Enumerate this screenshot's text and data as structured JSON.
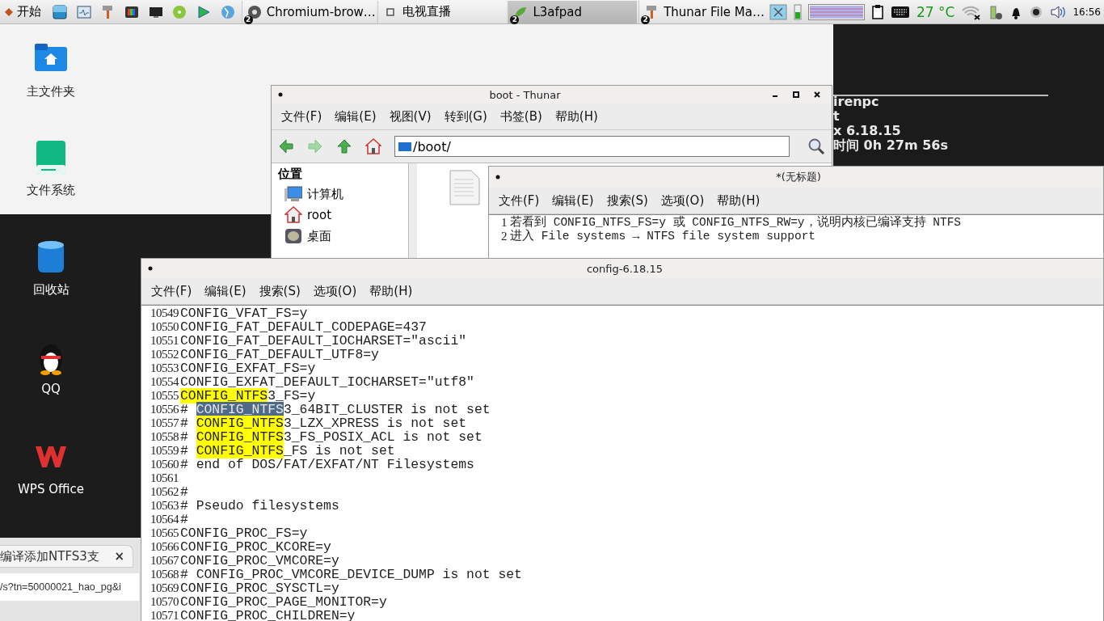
{
  "taskbar": {
    "start_label": "开始",
    "tasks": [
      {
        "label": "Chromium-brow…",
        "badge": "2",
        "kind": "browser",
        "selected": false
      },
      {
        "label": "电视直播",
        "kind": "tv",
        "selected": false
      },
      {
        "label": "L3afpad",
        "badge": "2",
        "kind": "editor",
        "selected": true
      },
      {
        "label": "Thunar File Ma…",
        "badge": "2",
        "kind": "files",
        "selected": false
      }
    ],
    "temperature": "27 °C",
    "clock": "16:56"
  },
  "desktop_icons": [
    {
      "label": "主文件夹",
      "kind": "home"
    },
    {
      "label": "文件系统",
      "kind": "drive"
    },
    {
      "label": "回收站",
      "kind": "trash"
    },
    {
      "label": "QQ",
      "kind": "penguin"
    },
    {
      "label": "WPS Office",
      "kind": "wps"
    }
  ],
  "system_info": {
    "lines": [
      "irenpc",
      "t",
      "x 6.18.15",
      "时间 0h 27m 56s"
    ]
  },
  "browser_fragment": {
    "tab_title": "编译添加NTFS3支",
    "close": "×",
    "address": "/s?tn=50000021_hao_pg&i"
  },
  "thunar": {
    "title": "boot - Thunar",
    "menu": [
      "文件(F)",
      "编辑(E)",
      "视图(V)",
      "转到(G)",
      "书签(B)",
      "帮助(H)"
    ],
    "path": "/boot/",
    "sidebar": {
      "heading": "位置",
      "items": [
        {
          "label": "计算机",
          "kind": "computer"
        },
        {
          "label": "root",
          "kind": "home"
        },
        {
          "label": "桌面",
          "kind": "desktop"
        }
      ]
    }
  },
  "notes_editor": {
    "title": "*(无标题)",
    "menu": [
      "文件(F)",
      "编辑(E)",
      "搜索(S)",
      "选项(O)",
      "帮助(H)"
    ],
    "lines": [
      {
        "number": "1",
        "text": "若看到 CONFIG_NTFS_FS=y 或 CONFIG_NTFS_RW=y，说明内核已编译支持 NTFS"
      },
      {
        "number": "2",
        "text": "进入 File systems → NTFS file system support"
      }
    ]
  },
  "config_editor": {
    "title": "config-6.18.15",
    "menu": [
      "文件(F)",
      "编辑(E)",
      "搜索(S)",
      "选项(O)",
      "帮助(H)"
    ],
    "lines": [
      {
        "number": "10549",
        "segments": [
          {
            "text": "CONFIG_VFAT_FS=y",
            "kind": "plain"
          }
        ]
      },
      {
        "number": "10550",
        "segments": [
          {
            "text": "CONFIG_FAT_DEFAULT_CODEPAGE=437",
            "kind": "plain"
          }
        ]
      },
      {
        "number": "10551",
        "segments": [
          {
            "text": "CONFIG_FAT_DEFAULT_IOCHARSET=\"ascii\"",
            "kind": "plain"
          }
        ]
      },
      {
        "number": "10552",
        "segments": [
          {
            "text": "CONFIG_FAT_DEFAULT_UTF8=y",
            "kind": "plain"
          }
        ]
      },
      {
        "number": "10553",
        "segments": [
          {
            "text": "CONFIG_EXFAT_FS=y",
            "kind": "plain"
          }
        ]
      },
      {
        "number": "10554",
        "segments": [
          {
            "text": "CONFIG_EXFAT_DEFAULT_IOCHARSET=\"utf8\"",
            "kind": "plain"
          }
        ]
      },
      {
        "number": "10555",
        "segments": [
          {
            "text": "CONFIG_NTFS",
            "kind": "match"
          },
          {
            "text": "3_FS=y",
            "kind": "plain"
          }
        ]
      },
      {
        "number": "10556",
        "segments": [
          {
            "text": "# ",
            "kind": "plain"
          },
          {
            "text": "CONFIG_NTFS",
            "kind": "selection"
          },
          {
            "text": "3_64BIT_CLUSTER is not set",
            "kind": "plain"
          }
        ]
      },
      {
        "number": "10557",
        "segments": [
          {
            "text": "# ",
            "kind": "plain"
          },
          {
            "text": "CONFIG_NTFS",
            "kind": "match"
          },
          {
            "text": "3_LZX_XPRESS is not set",
            "kind": "plain"
          }
        ]
      },
      {
        "number": "10558",
        "segments": [
          {
            "text": "# ",
            "kind": "plain"
          },
          {
            "text": "CONFIG_NTFS",
            "kind": "match"
          },
          {
            "text": "3_FS_POSIX_ACL is not set",
            "kind": "plain"
          }
        ]
      },
      {
        "number": "10559",
        "segments": [
          {
            "text": "# ",
            "kind": "plain"
          },
          {
            "text": "CONFIG_NTFS",
            "kind": "match"
          },
          {
            "text": "_FS is not set",
            "kind": "plain"
          }
        ]
      },
      {
        "number": "10560",
        "segments": [
          {
            "text": "# end of DOS/FAT/EXFAT/NT Filesystems",
            "kind": "plain"
          }
        ]
      },
      {
        "number": "10561"
      },
      {
        "number": "10562",
        "segments": [
          {
            "text": "#",
            "kind": "plain"
          }
        ]
      },
      {
        "number": "10563",
        "segments": [
          {
            "text": "# Pseudo filesystems",
            "kind": "plain"
          }
        ]
      },
      {
        "number": "10564",
        "segments": [
          {
            "text": "#",
            "kind": "plain"
          }
        ]
      },
      {
        "number": "10565",
        "segments": [
          {
            "text": "CONFIG_PROC_FS=y",
            "kind": "plain"
          }
        ]
      },
      {
        "number": "10566",
        "segments": [
          {
            "text": "CONFIG_PROC_KCORE=y",
            "kind": "plain"
          }
        ]
      },
      {
        "number": "10567",
        "segments": [
          {
            "text": "CONFIG_PROC_VMCORE=y",
            "kind": "plain"
          }
        ]
      },
      {
        "number": "10568",
        "segments": [
          {
            "text": "# CONFIG_PROC_VMCORE_DEVICE_DUMP is not set",
            "kind": "plain"
          }
        ]
      },
      {
        "number": "10569",
        "segments": [
          {
            "text": "CONFIG_PROC_SYSCTL=y",
            "kind": "plain"
          }
        ]
      },
      {
        "number": "10570",
        "segments": [
          {
            "text": "CONFIG_PROC_PAGE_MONITOR=y",
            "kind": "plain"
          }
        ]
      },
      {
        "number": "10571",
        "segments": [
          {
            "text": "CONFIG_PROC_CHILDREN=y",
            "kind": "plain"
          }
        ]
      }
    ]
  }
}
